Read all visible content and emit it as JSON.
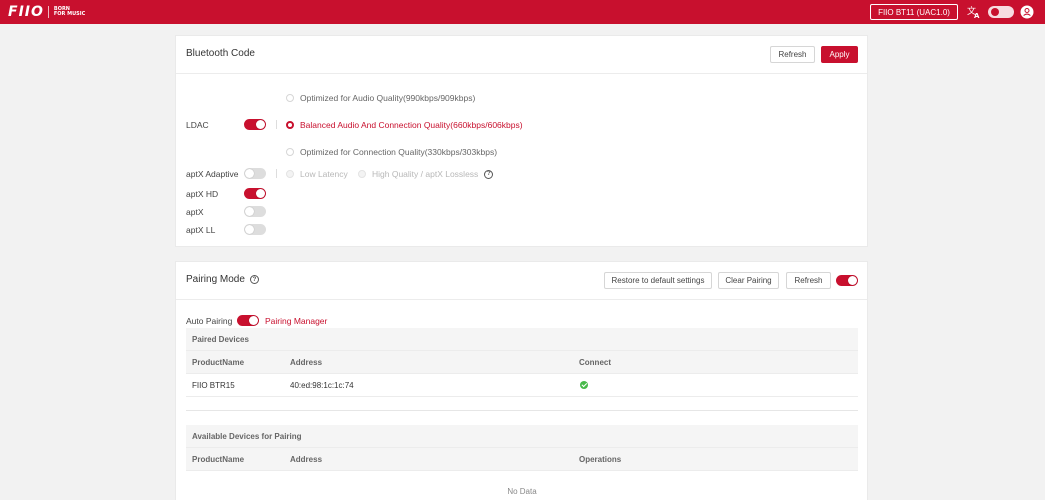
{
  "topbar": {
    "logo_mark": "FIIO",
    "logo_tag_line1": "BORN",
    "logo_tag_line2": "FOR MUSIC",
    "device_name": "FIIO BT11 (UAC1.0)",
    "icons": [
      "translate-icon",
      "theme-toggle",
      "user-icon"
    ]
  },
  "bluetooth_code": {
    "title": "Bluetooth Code",
    "refresh_label": "Refresh",
    "apply_label": "Apply",
    "ldac": {
      "label": "LDAC",
      "enabled": true,
      "options": [
        {
          "label": "Optimized for Audio Quality(990kbps/909kbps)",
          "selected": false
        },
        {
          "label": "Balanced Audio And Connection Quality(660kbps/606kbps)",
          "selected": true
        },
        {
          "label": "Optimized for Connection Quality(330kbps/303kbps)",
          "selected": false
        }
      ]
    },
    "aptx_adaptive": {
      "label": "aptX Adaptive",
      "enabled": false,
      "options": [
        {
          "label": "Low Latency",
          "selected": false
        },
        {
          "label": "High Quality / aptX Lossless",
          "selected": false
        }
      ]
    },
    "aptx_hd": {
      "label": "aptX HD",
      "enabled": true
    },
    "aptx": {
      "label": "aptX",
      "enabled": false
    },
    "aptx_ll": {
      "label": "aptX LL",
      "enabled": false
    }
  },
  "pairing_mode": {
    "title": "Pairing Mode",
    "enabled": true,
    "restore_label": "Restore to default settings",
    "clear_label": "Clear Pairing",
    "refresh_label": "Refresh",
    "auto_pairing_label": "Auto Pairing",
    "auto_pairing_enabled": true,
    "pairing_manager_label": "Pairing Manager",
    "paired": {
      "caption": "Paired Devices",
      "headers": [
        "ProductName",
        "Address",
        "Connect"
      ],
      "rows": [
        {
          "product": "FIIO BTR15",
          "address": "40:ed:98:1c:1c:74",
          "connected": true
        }
      ]
    },
    "available": {
      "caption": "Available Devices for Pairing",
      "headers": [
        "ProductName",
        "Address",
        "Operations"
      ],
      "empty_text": "No Data"
    }
  },
  "colors": {
    "brand": "#c8102e",
    "success": "#47b94a",
    "background": "#f2f2f2"
  }
}
